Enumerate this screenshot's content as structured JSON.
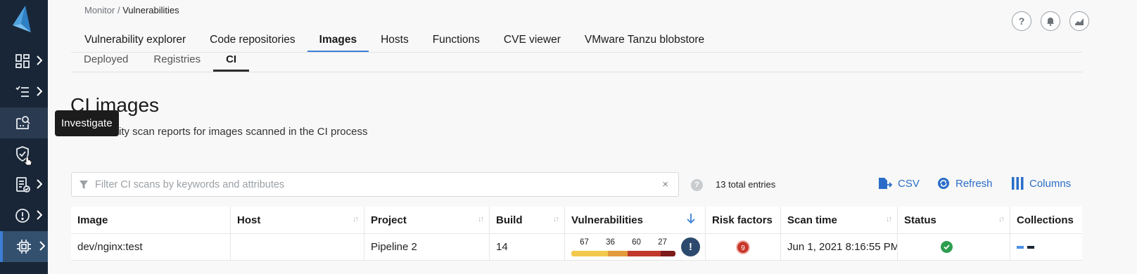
{
  "header": {
    "breadcrumb_parent": "Monitor",
    "breadcrumb_sep": " / ",
    "breadcrumb_current": "Vulnerabilities",
    "icons": [
      "help-icon",
      "bell-icon",
      "chart-icon"
    ]
  },
  "sidebar": {
    "items": [
      {
        "name": "dashboard-icon",
        "has_chevron": true
      },
      {
        "name": "list-icon",
        "has_chevron": true
      },
      {
        "name": "investigate-icon",
        "has_chevron": false,
        "hover": true
      },
      {
        "name": "shield-check-icon",
        "has_chevron": false
      },
      {
        "name": "compliance-icon",
        "has_chevron": true
      },
      {
        "name": "alert-icon",
        "has_chevron": true
      },
      {
        "name": "cpu-icon",
        "has_chevron": true,
        "active": true
      }
    ],
    "tooltip": "Investigate"
  },
  "tabs": [
    {
      "label": "Vulnerability explorer",
      "active": false
    },
    {
      "label": "Code repositories",
      "active": false
    },
    {
      "label": "Images",
      "active": true
    },
    {
      "label": "Hosts",
      "active": false
    },
    {
      "label": "Functions",
      "active": false
    },
    {
      "label": "CVE viewer",
      "active": false
    },
    {
      "label": "VMware Tanzu blobstore",
      "active": false
    }
  ],
  "subtabs": [
    {
      "label": "Deployed",
      "active": false
    },
    {
      "label": "Registries",
      "active": false
    },
    {
      "label": "CI",
      "active": true
    }
  ],
  "page": {
    "title": "CI images",
    "description": "ity scan reports for images scanned in the CI process"
  },
  "filter": {
    "placeholder": "Filter CI scans by keywords and attributes",
    "value": "",
    "clear": "×"
  },
  "toolbar": {
    "help": "?",
    "total_entries": "13 total entries",
    "csv_label": "CSV",
    "refresh_label": "Refresh",
    "columns_label": "Columns"
  },
  "table": {
    "columns": [
      "Image",
      "Host",
      "Project",
      "Build",
      "Vulnerabilities",
      "Risk factors",
      "Scan time",
      "Status",
      "Collections"
    ],
    "rows": [
      {
        "image": "dev/nginx:test",
        "host": "",
        "project": "Pipeline 2",
        "build": "14",
        "vulnerabilities": {
          "low": "67",
          "medium": "36",
          "high": "60",
          "critical": "27",
          "badge": "!"
        },
        "risk_factors": "9",
        "scan_time": "Jun 1, 2021 8:16:55 PM",
        "status": "ok",
        "collections": [
          "#4a90e2",
          "#1b2533"
        ]
      }
    ]
  },
  "colors": {
    "sidebar_bg": "#192637",
    "accent": "#3d7fd6",
    "link": "#2a6dc9",
    "vul_low": "#f2c94c",
    "vul_medium": "#e39a3b",
    "vul_high": "#c0392b",
    "vul_critical": "#7e1b1b",
    "status_ok": "#2e9d4f",
    "risk": "#c9362c"
  }
}
